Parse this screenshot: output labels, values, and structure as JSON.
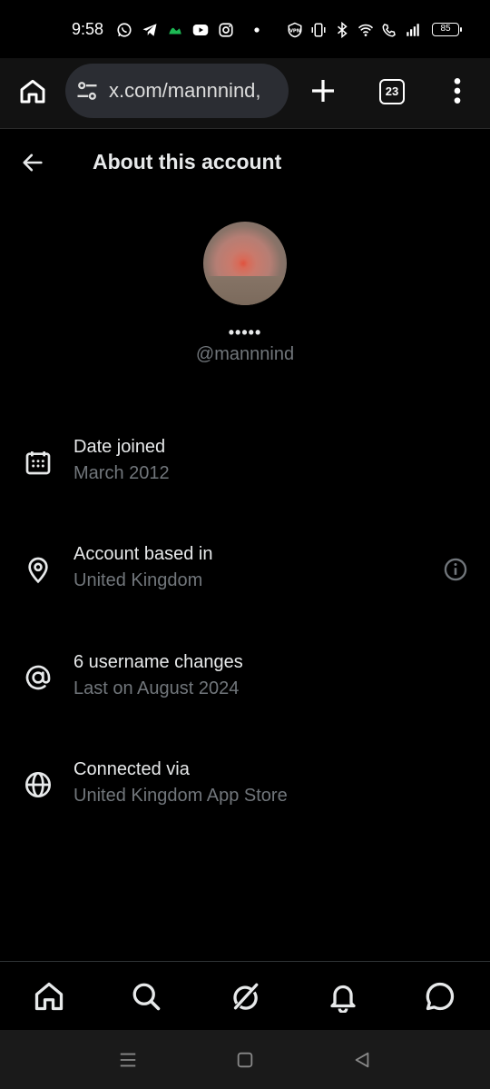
{
  "status_bar": {
    "time": "9:58",
    "battery": "85",
    "left_icons": [
      "whatsapp-icon",
      "telegram-icon",
      "app-icon",
      "youtube-icon",
      "instagram-icon",
      "dot-icon"
    ],
    "right_icons": [
      "vpn-icon",
      "vibrate-icon",
      "bluetooth-icon",
      "wifi-icon",
      "wifi-call-icon",
      "signal-icon"
    ]
  },
  "browser": {
    "url": "x.com/mannnind,",
    "tab_count": "23"
  },
  "header": {
    "title": "About this account"
  },
  "profile": {
    "display_name": "•••••",
    "handle": "@mannnind"
  },
  "details": [
    {
      "title": "Date joined",
      "subtitle": "March 2012",
      "icon": "calendar-icon"
    },
    {
      "title": "Account based in",
      "subtitle": "United Kingdom",
      "icon": "location-pin-icon"
    },
    {
      "title": "6 username changes",
      "subtitle": "Last on August 2024",
      "icon": "at-sign-icon"
    },
    {
      "title": "Connected via",
      "subtitle": "United Kingdom App Store",
      "icon": "globe-icon"
    }
  ],
  "bottom_nav": [
    "home-icon",
    "search-icon",
    "grok-icon",
    "notifications-icon",
    "messages-icon"
  ],
  "colors": {
    "background": "#000000",
    "primary_text": "#e7e9ea",
    "secondary_text": "#71767b",
    "url_pill": "#2b2d33"
  }
}
